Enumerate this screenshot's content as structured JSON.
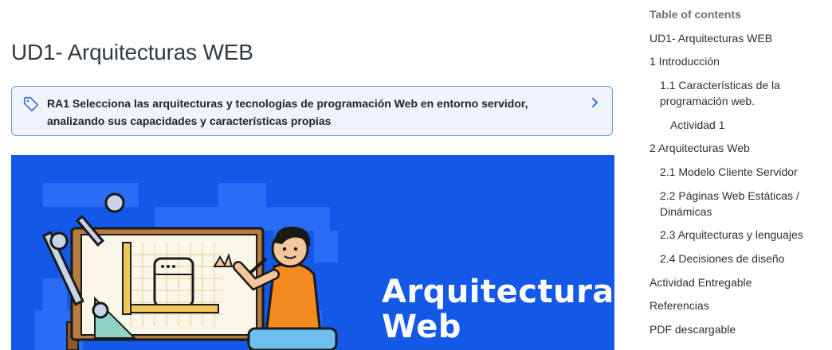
{
  "page": {
    "title": "UD1- Arquitecturas WEB"
  },
  "callout": {
    "text": "RA1 Selecciona las arquitecturas y tecnologías de programación Web en entorno servidor, analizando sus capacidades y características propias",
    "icon": "tag-icon",
    "chevron_icon": "chevron-right-icon",
    "border_color": "#6b94dc",
    "background": "#eef3fc"
  },
  "hero": {
    "text_line1": "Arquitectura",
    "text_line2": "Web",
    "background": "#1458e8"
  },
  "toc": {
    "title": "Table of contents",
    "items": [
      {
        "label": "UD1- Arquitecturas WEB"
      },
      {
        "label": "1 Introducción"
      },
      {
        "label_line1": "1.1 Características de la",
        "label_line2": "programación web."
      },
      {
        "label": "Actividad 1"
      },
      {
        "label": "2 Arquitecturas Web"
      },
      {
        "label": "2.1 Modelo Cliente Servidor"
      },
      {
        "label_line1": "2.2 Páginas Web Estáticas /",
        "label_line2": "Dinámicas"
      },
      {
        "label": "2.3 Arquitecturas y lenguajes"
      },
      {
        "label": "2.4 Decisiones de diseño"
      },
      {
        "label": "Actividad Entregable"
      },
      {
        "label": "Referencias"
      },
      {
        "label": "PDF descargable"
      }
    ]
  }
}
